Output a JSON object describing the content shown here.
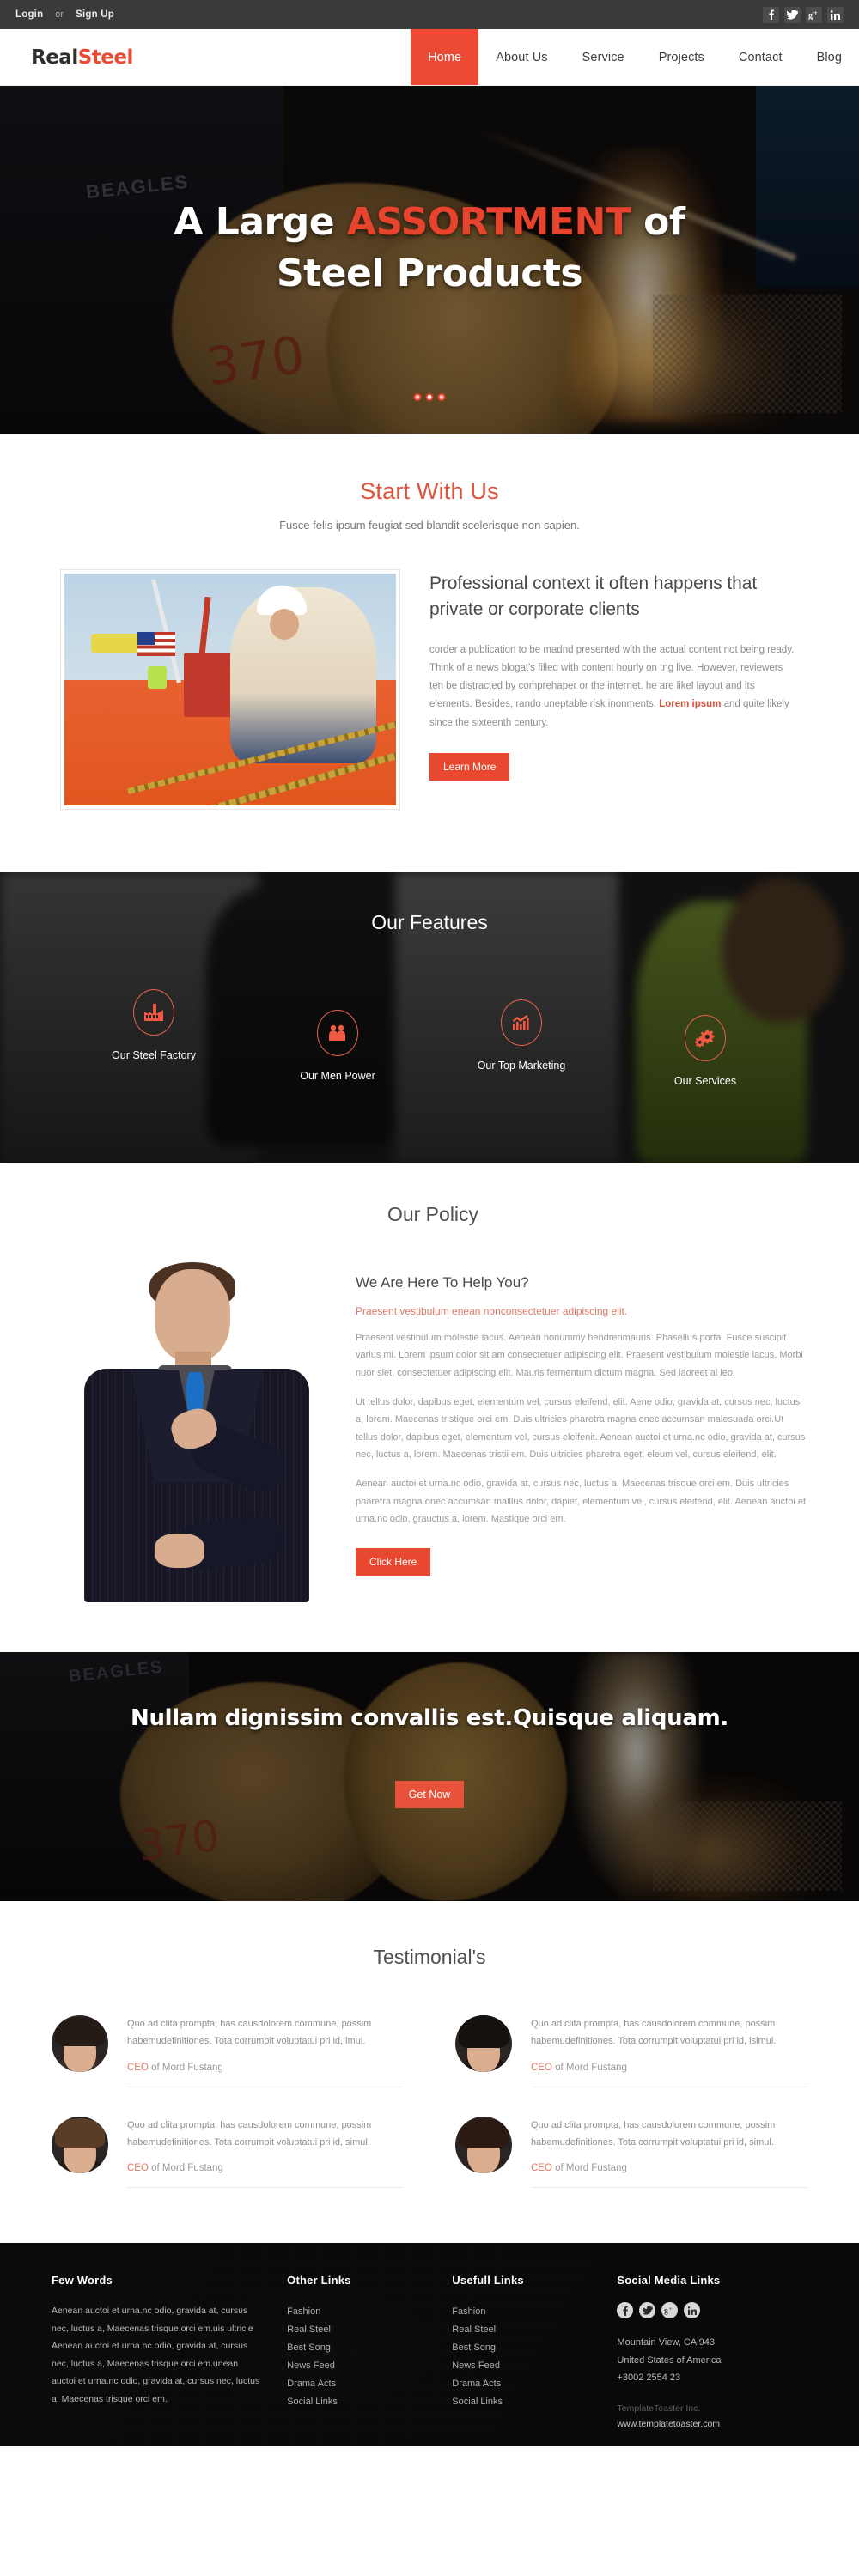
{
  "topbar": {
    "login": "Login",
    "or": "or",
    "signup": "Sign Up",
    "social": [
      {
        "name": "facebook-icon",
        "label": "f"
      },
      {
        "name": "twitter-icon",
        "label": "t"
      },
      {
        "name": "google-plus-icon",
        "label": "g+"
      },
      {
        "name": "linkedin-icon",
        "label": "in"
      }
    ]
  },
  "brand": {
    "part1": "Real",
    "part2": "Steel"
  },
  "nav": [
    {
      "label": "Home",
      "active": true
    },
    {
      "label": "About Us",
      "active": false
    },
    {
      "label": "Service",
      "active": false
    },
    {
      "label": "Projects",
      "active": false
    },
    {
      "label": "Contact",
      "active": false
    },
    {
      "label": "Blog",
      "active": false
    }
  ],
  "hero": {
    "line1_a": "A Large ",
    "line1_hl": "ASSORTMENT",
    "line1_b": " of",
    "line2": "Steel Products",
    "slides": 3,
    "active_slide": 1,
    "overlay_text_1": "BEAGLES",
    "overlay_text_2": "370"
  },
  "start": {
    "title": "Start With Us",
    "subtitle": "Fusce felis ipsum feugiat sed blandit scelerisque non sapien.",
    "heading": "Professional context it often happens that private or corporate clients",
    "paragraph_a": "corder a publication to be madnd presented with the actual content not being ready. Think of a news blogat's filled with content hourly on tng live. However, reviewers ten be distracted by comprehaper or the internet. he are likel layout and its elements. Besides, rando uneptable risk inonments. ",
    "paragraph_hl": "Lorem ipsum",
    "paragraph_b": " and quite likely since the sixteenth century.",
    "button": "Learn More"
  },
  "features": {
    "title": "Our Features",
    "items": [
      {
        "label": "Our Steel Factory",
        "icon": "factory-icon"
      },
      {
        "label": "Our Men Power",
        "icon": "people-icon"
      },
      {
        "label": "Our Top Marketing",
        "icon": "bar-chart-icon"
      },
      {
        "label": "Our Services",
        "icon": "gears-icon"
      }
    ]
  },
  "policy": {
    "title": "Our Policy",
    "heading": "We Are Here To Help You?",
    "lead": "Praesent vestibulum enean nonconsectetuer adipiscing elit.",
    "p1": "Praesent vestibulum molestie lacus. Aenean nonummy hendrerimauris. Phasellus porta. Fusce suscipit varius mi. Lorem ipsum dolor sit am consectetuer adipiscing elit. Praesent vestibulum molestie lacus. Morbi nuor siet, consectetuer adipiscing elit. Mauris fermentum dictum magna. Sed laoreet al leo.",
    "p2": "Ut tellus dolor, dapibus eget, elementum vel, cursus eleifend, elit. Aene odio, gravida at, cursus nec, luctus a, lorem. Maecenas tristique orci em. Duis ultricies pharetra magna onec accumsan malesuada orci.Ut tellus dolor, dapibus eget, elementum vel, cursus eleifenit. Aenean auctoi et urna.nc odio, gravida at, cursus nec, luctus a, lorem. Maecenas tristii em. Duis ultricies pharetra eget, eleum vel, cursus eleifend, elit.",
    "p3": "Aenean auctoi et urna.nc odio, gravida at, cursus nec, luctus a, Maecenas trisque orci em. Duis ultricies pharetra magna onec accumsan malllus dolor, dapiet, elementum vel, cursus eleifend, elit. Aenean auctoi et urna.nc odio, grauctus a, lorem. Mastique orci em.",
    "button": "Click Here"
  },
  "cta": {
    "heading": "Nullam dignissim convallis est.Quisque aliquam.",
    "button": "Get Now",
    "overlay_text_1": "BEAGLES",
    "overlay_text_2": "370"
  },
  "testimonials": {
    "title": "Testimonial's",
    "items": [
      {
        "text": "Quo ad clita prompta, has causdolorem commune, possim habemudefinitiones. Tota corrumpit voluptatui pri id, imul.",
        "role": "CEO",
        "author": " of Mord Fustang",
        "avatar": "avatar-woman-dark-hair"
      },
      {
        "text": "Quo ad clita prompta, has causdolorem commune, possim habemudefinitiones. Tota corrumpit voluptatui pri id, isimul.",
        "role": "CEO",
        "author": " of Mord Fustang",
        "avatar": "avatar-man-hat"
      },
      {
        "text": "Quo ad clita prompta, has causdolorem commune, possim habemudefinitiones. Tota corrumpit voluptatui pri id, simul.",
        "role": "CEO",
        "author": " of Mord Fustang",
        "avatar": "avatar-man-brown-hair"
      },
      {
        "text": "Quo ad clita prompta, has causdolorem commune, possim habemudefinitiones. Tota corrumpit voluptatui pri id, simul.",
        "role": "CEO",
        "author": " of Mord Fustang",
        "avatar": "avatar-woman-red-hair"
      }
    ]
  },
  "footer": {
    "few_words": {
      "title": "Few Words",
      "text": "Aenean auctoi et urna.nc odio, gravida at, cursus nec, luctus a, Maecenas trisque orci em.uis ultricie Aenean auctoi et urna.nc odio, gravida at, cursus nec, luctus a, Maecenas trisque orci em.unean auctoi et urna.nc odio, gravida at, cursus nec, luctus a, Maecenas trisque orci em."
    },
    "other_links": {
      "title": "Other Links",
      "items": [
        "Fashion",
        "Real Steel",
        "Best Song",
        "News Feed",
        "Drama Acts",
        "Social Links"
      ]
    },
    "usefull_links": {
      "title": "Usefull Links",
      "items": [
        "Fashion",
        "Real Steel",
        "Best Song",
        "News Feed",
        "Drama Acts",
        "Social Links"
      ]
    },
    "social": {
      "title": "Social Media Links",
      "icons": [
        {
          "name": "facebook-icon",
          "label": "f"
        },
        {
          "name": "twitter-icon",
          "label": "t"
        },
        {
          "name": "google-plus-icon",
          "label": "g+"
        },
        {
          "name": "linkedin-icon",
          "label": "in"
        }
      ],
      "address_line1": "Mountain View, CA 943",
      "address_line2": "United States of America",
      "phone": "+3002 2554 23",
      "company": "TemplateToaster Inc.",
      "website": "www.templatetoaster.com"
    }
  },
  "colors": {
    "accent": "#e8482f",
    "accent_soft": "#e0543d",
    "topbar_bg": "#3a3a3a",
    "footer_bg": "#121212"
  }
}
